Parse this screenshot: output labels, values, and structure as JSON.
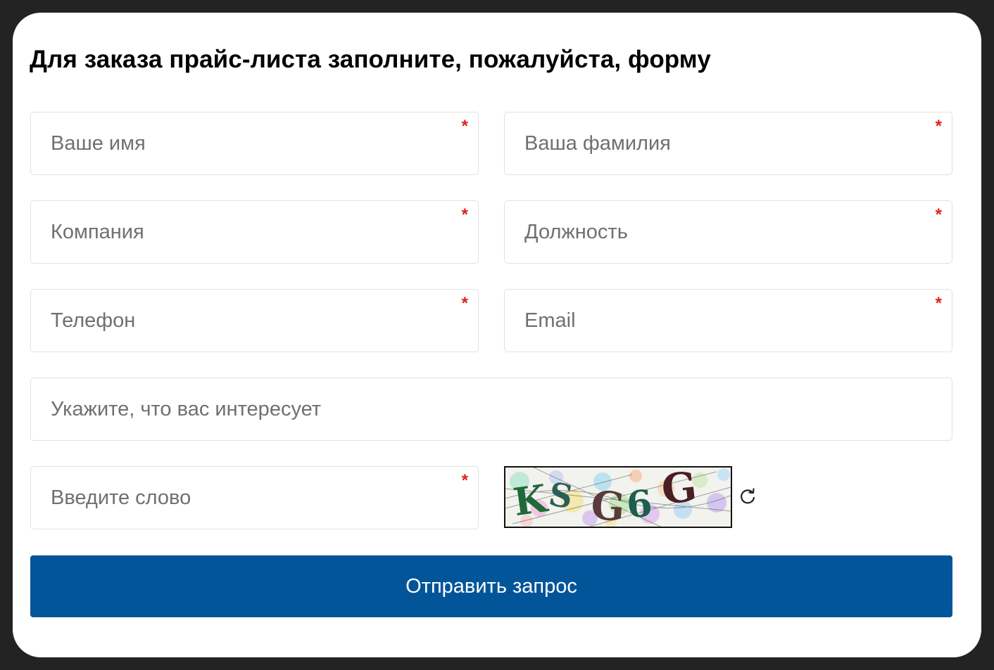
{
  "form": {
    "title": "Для заказа прайс-листа заполните, пожалуйста, форму",
    "required_mark": "*",
    "fields": {
      "first_name": {
        "placeholder": "Ваше имя",
        "value": "",
        "required": true
      },
      "last_name": {
        "placeholder": "Ваша фамилия",
        "value": "",
        "required": true
      },
      "company": {
        "placeholder": "Компания",
        "value": "",
        "required": true
      },
      "position": {
        "placeholder": "Должность",
        "value": "",
        "required": true
      },
      "phone": {
        "placeholder": "Телефон",
        "value": "",
        "required": true
      },
      "email": {
        "placeholder": "Email",
        "value": "",
        "required": true
      },
      "interest": {
        "placeholder": "Укажите, что вас интересует",
        "value": "",
        "required": false
      },
      "captcha_word": {
        "placeholder": "Введите слово",
        "value": "",
        "required": true
      }
    },
    "captcha": {
      "text": "KS G6 G",
      "chars": [
        "K",
        "S",
        "G",
        "6",
        "G"
      ]
    },
    "refresh_icon": "refresh-icon",
    "submit_label": "Отправить запрос"
  },
  "colors": {
    "frame": "#232323",
    "card": "#ffffff",
    "required": "#e0201f",
    "placeholder": "#707070",
    "field_border": "#e1e1e1",
    "button": "#03559a",
    "button_text": "#ffffff"
  }
}
